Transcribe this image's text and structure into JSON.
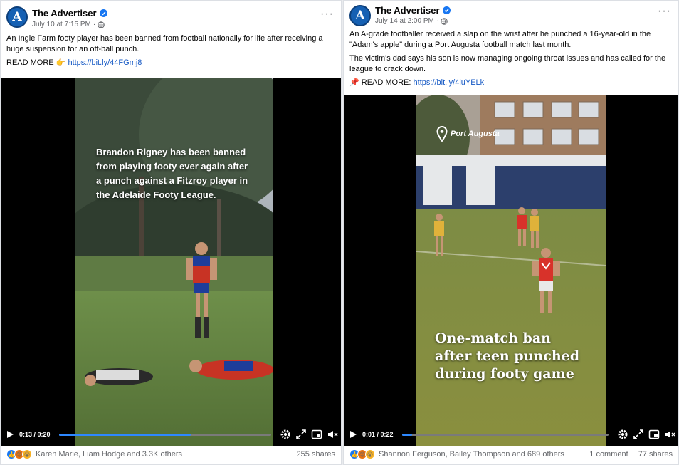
{
  "posts": [
    {
      "page_name": "The Advertiser",
      "avatar_letter": "A",
      "date": "July 10 at 7:15 PM",
      "text_lines": [
        "An Ingle Farm footy player has been banned from football nationally for life after receiving a huge suspension for an off-ball punch."
      ],
      "read_more": "READ MORE",
      "read_more_emoji": "👉",
      "link": "https://bit.ly/44FGmj8",
      "video": {
        "overlay": "Brandon Rigney has been banned from playing footy ever again after a punch against a Fitzroy player in the Adelaide Footy League.",
        "current_time": "0:13",
        "duration": "0:20",
        "progress": 0.62
      },
      "reactions": [
        "like",
        "angry",
        "wow"
      ],
      "reaction_names": "Karen Marie, Liam Hodge and 3.3K others",
      "comments": "",
      "shares": "255 shares"
    },
    {
      "page_name": "The Advertiser",
      "avatar_letter": "A",
      "date": "July 14 at 2:00 PM",
      "text_lines": [
        "An A-grade footballer received a slap on the wrist after he punched a 16-year-old in the \"Adam's apple\" during a Port Augusta football match last month.",
        "The victim's dad says his son is now managing ongoing throat issues and has called for the league to crack down."
      ],
      "read_more": "READ MORE:",
      "read_more_emoji": "📌",
      "link": "https://bit.ly/4luYELk",
      "video": {
        "location": "Port Augusta",
        "overlay": "One-match ban after teen punched during footy game",
        "current_time": "0:01",
        "duration": "0:22",
        "progress": 0.05
      },
      "reactions": [
        "like",
        "angry",
        "wow"
      ],
      "reaction_names": "Shannon Ferguson, Bailey Thompson and 689 others",
      "comments": "1 comment",
      "shares": "77 shares"
    }
  ],
  "colors": {
    "brand": "#1560b3",
    "link": "#1458c4",
    "progress": "#2d88ff"
  }
}
